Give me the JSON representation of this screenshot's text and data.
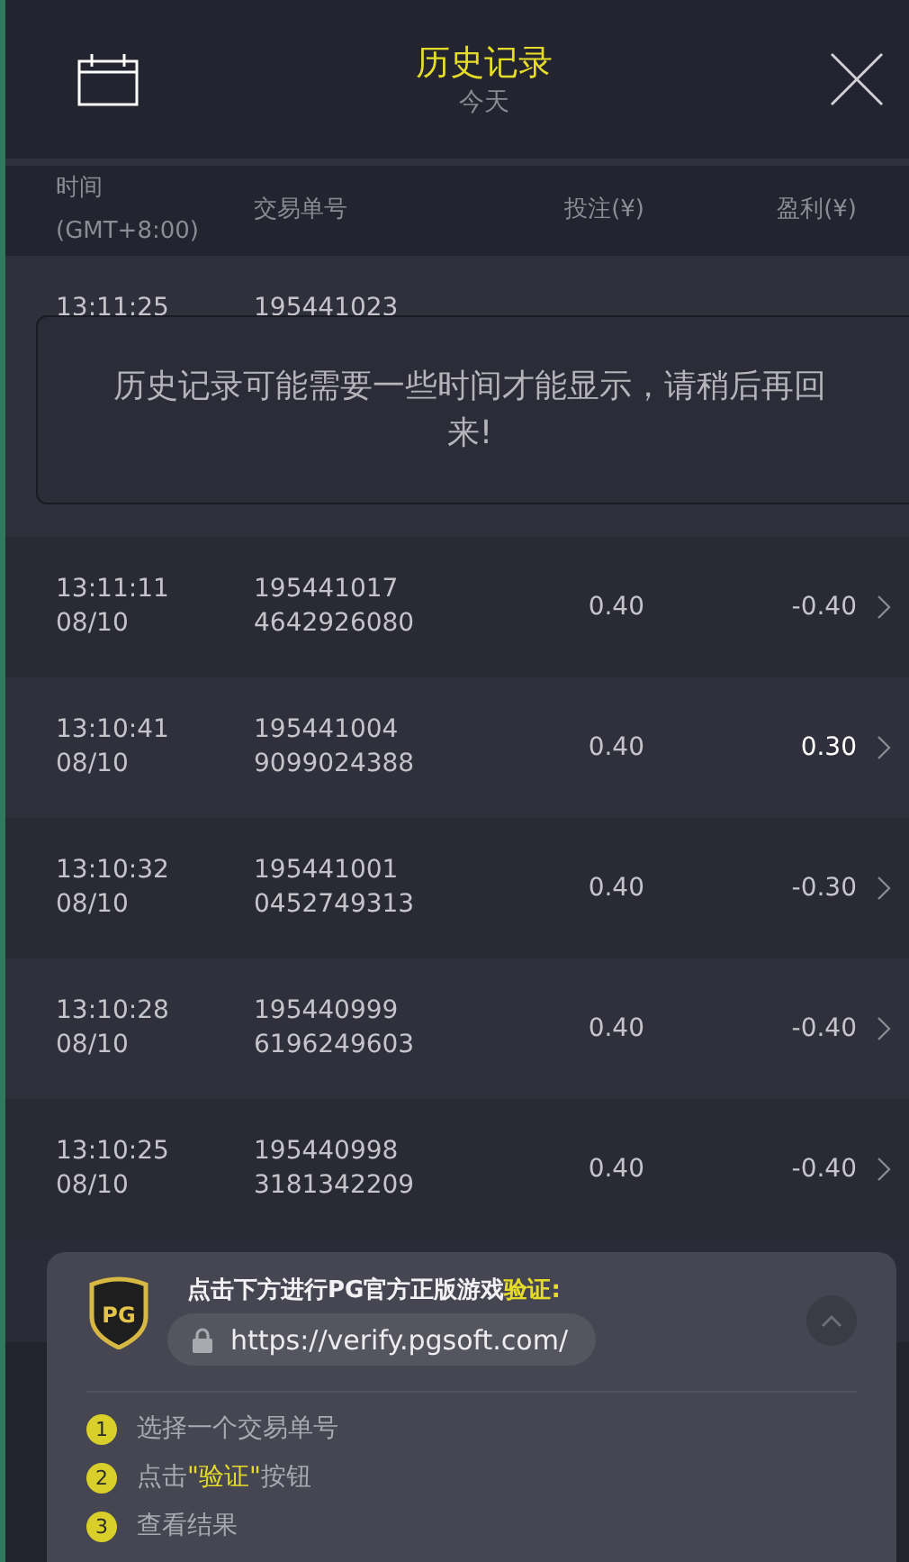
{
  "header": {
    "title": "历史记录",
    "subtitle": "今天"
  },
  "table": {
    "columns": [
      {
        "line1": "时间",
        "line2": "(GMT+8:00)"
      },
      {
        "line1": "交易单号"
      },
      {
        "line1": "投注(¥)"
      },
      {
        "line1": "盈利(¥)"
      }
    ],
    "rows": [
      {
        "time": "13:11:25",
        "id": "195441023",
        "partial": true
      },
      {
        "time": "13:11:11",
        "date": "08/10",
        "id": "195441017",
        "id2": "4642926080",
        "bet": "0.40",
        "profit": "-0.40",
        "positive": false
      },
      {
        "time": "13:10:41",
        "date": "08/10",
        "id": "195441004",
        "id2": "9099024388",
        "bet": "0.40",
        "profit": "0.30",
        "positive": true
      },
      {
        "time": "13:10:32",
        "date": "08/10",
        "id": "195441001",
        "id2": "0452749313",
        "bet": "0.40",
        "profit": "-0.30",
        "positive": false
      },
      {
        "time": "13:10:28",
        "date": "08/10",
        "id": "195440999",
        "id2": "6196249603",
        "bet": "0.40",
        "profit": "-0.40",
        "positive": false
      },
      {
        "time": "13:10:25",
        "date": "08/10",
        "id": "195440998",
        "id2": "3181342209",
        "bet": "0.40",
        "profit": "-0.40",
        "positive": false
      }
    ]
  },
  "toast": {
    "message": "历史记录可能需要一些时间才能显示，请稍后再回来!"
  },
  "verify_panel": {
    "heading": [
      {
        "text": "点击下方进行PG官方正版游戏",
        "highlight": false
      },
      {
        "text": "验证:",
        "highlight": true
      }
    ],
    "badge": "PG",
    "url": "https://verify.pgsoft.com/",
    "expanded": true,
    "steps": [
      {
        "number": "1",
        "parts": [
          {
            "text": "选择一个交易单号",
            "highlight": false
          }
        ]
      },
      {
        "number": "2",
        "parts": [
          {
            "text": "点击",
            "highlight": false
          },
          {
            "text": "\"验证\"",
            "highlight": true
          },
          {
            "text": "按钮",
            "highlight": false
          }
        ]
      },
      {
        "number": "3",
        "parts": [
          {
            "text": "查看结果",
            "highlight": false
          }
        ]
      }
    ]
  }
}
